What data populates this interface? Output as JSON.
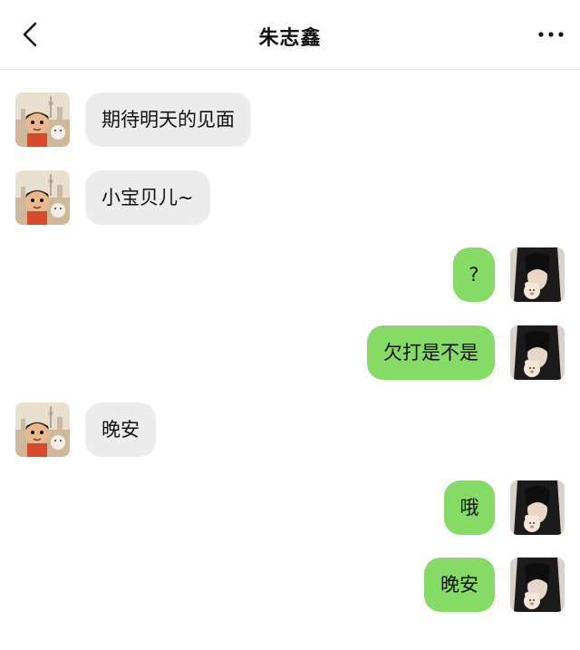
{
  "header": {
    "title": "朱志鑫",
    "back_icon": "chevron-left-icon",
    "more_icon": "more-horizontal-icon"
  },
  "colors": {
    "outgoing_bubble": "#85db65",
    "incoming_bubble": "#ececec"
  },
  "messages": [
    {
      "side": "incoming",
      "text": "期待明天的见面"
    },
    {
      "side": "incoming",
      "text": "小宝贝儿~"
    },
    {
      "side": "outgoing",
      "text": "?"
    },
    {
      "side": "outgoing",
      "text": "欠打是不是"
    },
    {
      "side": "incoming",
      "text": "晚安"
    },
    {
      "side": "outgoing",
      "text": "哦"
    },
    {
      "side": "outgoing",
      "text": "晚安"
    }
  ]
}
